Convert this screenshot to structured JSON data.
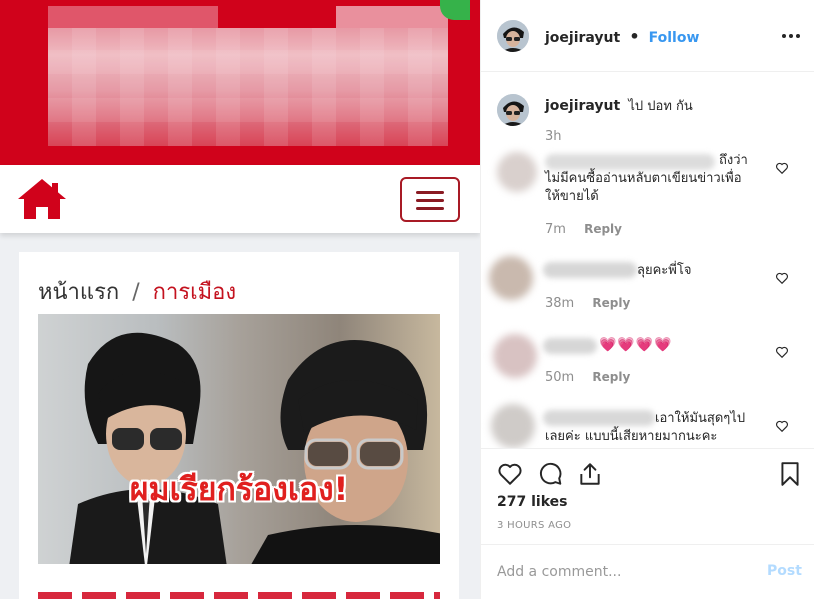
{
  "post_image": {
    "breadcrumb_home": "หน้าแรก",
    "breadcrumb_sep": "/",
    "breadcrumb_category": "การเมือง",
    "headline_overlay": "ผมเรียกร้องเอง!"
  },
  "header": {
    "username": "joejirayut",
    "separator": "•",
    "follow_label": "Follow"
  },
  "caption": {
    "username": "joejirayut",
    "text": "ไป ปอท กัน",
    "time": "3h"
  },
  "comments": [
    {
      "text_line1": "ถึงว่า",
      "text_line2": "ไม่มีคนซื้ออ่านหลับตาเขียนข่าวเพื่อ",
      "text_line3": "ให้ขายได้",
      "time": "7m",
      "reply_label": "Reply"
    },
    {
      "text_line1": "ลุยคะพี่โจ",
      "time": "38m",
      "reply_label": "Reply"
    },
    {
      "text_line1": "💗💗💗💗",
      "time": "50m",
      "reply_label": "Reply"
    },
    {
      "text_line1": "เอาให้มันสุดๆไป",
      "text_line2": "เลยค่ะ แบบนี้เสียหายมากนะคะ"
    }
  ],
  "actions": {
    "likes": "277 likes",
    "timestamp": "3 HOURS AGO"
  },
  "add_comment": {
    "placeholder": "Add a comment...",
    "post_label": "Post"
  },
  "icons": {
    "like": "heart-icon",
    "comment": "comment-icon",
    "share": "share-icon",
    "save": "bookmark-icon",
    "more": "more-options-icon",
    "home": "home-icon",
    "menu": "hamburger-menu-icon"
  },
  "colors": {
    "site_red": "#d0021b",
    "follow_blue": "#3897f0",
    "post_disabled": "#b3dbff"
  }
}
